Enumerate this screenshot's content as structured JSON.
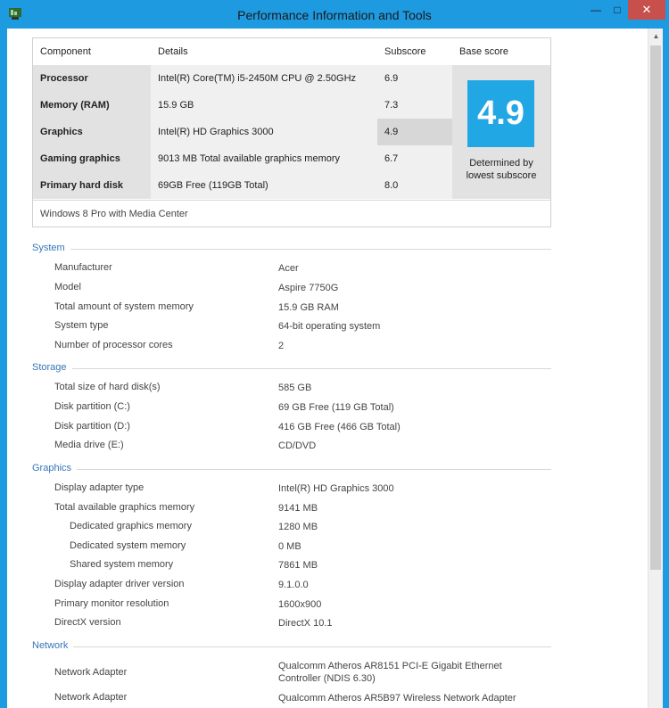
{
  "window": {
    "title": "Performance Information and Tools",
    "controls": {
      "minimize": "—",
      "maximize": "□",
      "close": "✕"
    }
  },
  "scores": {
    "headers": {
      "component": "Component",
      "details": "Details",
      "subscore": "Subscore",
      "base": "Base score"
    },
    "rows": [
      {
        "component": "Processor",
        "details": "Intel(R) Core(TM) i5-2450M CPU @ 2.50GHz",
        "subscore": "6.9"
      },
      {
        "component": "Memory (RAM)",
        "details": "15.9 GB",
        "subscore": "7.3"
      },
      {
        "component": "Graphics",
        "details": "Intel(R) HD Graphics 3000",
        "subscore": "4.9"
      },
      {
        "component": "Gaming graphics",
        "details": "9013 MB Total available graphics memory",
        "subscore": "6.7"
      },
      {
        "component": "Primary hard disk",
        "details": "69GB Free (119GB Total)",
        "subscore": "8.0"
      }
    ],
    "base_score": "4.9",
    "determined_line1": "Determined by",
    "determined_line2": "lowest subscore",
    "edition": "Windows 8 Pro with Media Center"
  },
  "system": {
    "title": "System",
    "items": [
      {
        "label": "Manufacturer",
        "value": "Acer"
      },
      {
        "label": "Model",
        "value": "Aspire 7750G"
      },
      {
        "label": "Total amount of system memory",
        "value": "15.9 GB RAM"
      },
      {
        "label": "System type",
        "value": "64-bit operating system"
      },
      {
        "label": "Number of processor cores",
        "value": "2"
      }
    ]
  },
  "storage": {
    "title": "Storage",
    "items": [
      {
        "label": "Total size of hard disk(s)",
        "value": "585 GB"
      },
      {
        "label": "Disk partition (C:)",
        "value": "69 GB Free (119 GB Total)"
      },
      {
        "label": "Disk partition (D:)",
        "value": "416 GB Free (466 GB Total)"
      },
      {
        "label": "Media drive (E:)",
        "value": "CD/DVD"
      }
    ]
  },
  "graphics": {
    "title": "Graphics",
    "items": [
      {
        "label": "Display adapter type",
        "value": "Intel(R) HD Graphics 3000"
      },
      {
        "label": "Total available graphics memory",
        "value": "9141 MB"
      },
      {
        "label": "Dedicated graphics memory",
        "value": "1280 MB"
      },
      {
        "label": "Dedicated system memory",
        "value": "0 MB"
      },
      {
        "label": "Shared system memory",
        "value": "7861 MB"
      },
      {
        "label": "Display adapter driver version",
        "value": "9.1.0.0"
      },
      {
        "label": "Primary monitor resolution",
        "value": "1600x900"
      },
      {
        "label": "DirectX version",
        "value": "DirectX 10.1"
      }
    ]
  },
  "network": {
    "title": "Network",
    "items": [
      {
        "label": "Network Adapter",
        "value_line1": "Qualcomm Atheros AR8151 PCI-E Gigabit Ethernet",
        "value_line2": "Controller (NDIS 6.30)"
      },
      {
        "label": "Network Adapter",
        "value_line1": "Qualcomm Atheros AR5B97 Wireless Network Adapter"
      }
    ]
  }
}
